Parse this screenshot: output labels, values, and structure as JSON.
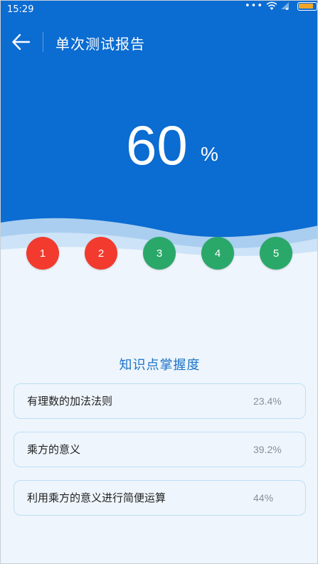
{
  "status_bar": {
    "time": "15:29",
    "more_indicator": "•••",
    "battery_level": 0.85,
    "battery_color": "#f3a52b"
  },
  "header": {
    "title": "单次测试报告",
    "back_icon": "arrow-left-icon"
  },
  "score": {
    "value": "60",
    "unit": "%"
  },
  "questions": [
    {
      "label": "1",
      "status": "wrong",
      "color": "#f23a2f"
    },
    {
      "label": "2",
      "status": "wrong",
      "color": "#f23a2f"
    },
    {
      "label": "3",
      "status": "correct",
      "color": "#2aa869"
    },
    {
      "label": "4",
      "status": "correct",
      "color": "#2aa869"
    },
    {
      "label": "5",
      "status": "correct",
      "color": "#2aa869"
    }
  ],
  "knowledge": {
    "title": "知识点掌握度",
    "items": [
      {
        "name": "有理数的加法法则",
        "rate": "23.4%"
      },
      {
        "name": "乘方的意义",
        "rate": "39.2%"
      },
      {
        "name": "利用乘方的意义进行简便运算",
        "rate": "44%"
      }
    ]
  },
  "colors": {
    "hero_blue": "#0b6cd2",
    "page_background": "#eef5fc",
    "accent_text": "#1a73c7",
    "card_border": "#bde0f5"
  }
}
